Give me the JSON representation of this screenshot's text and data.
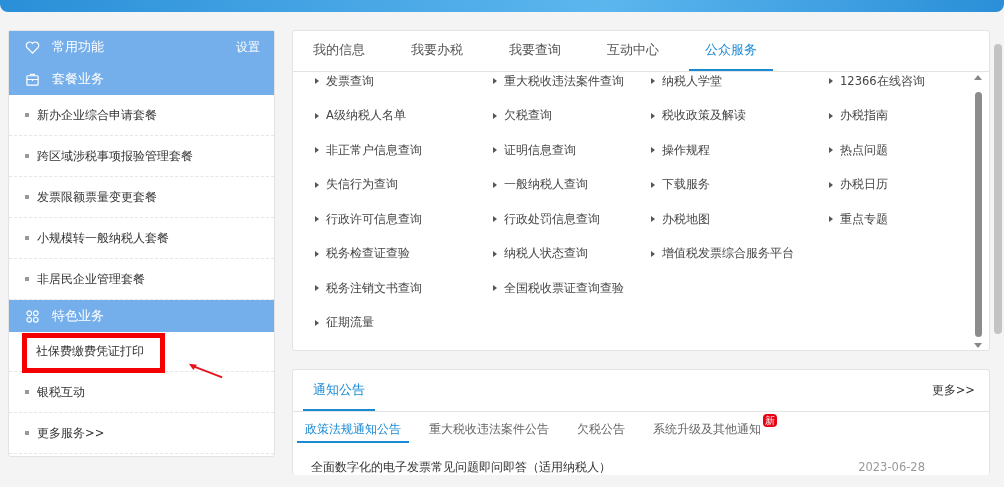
{
  "sidebar": {
    "sections": [
      {
        "title": "常用功能",
        "action": "设置"
      },
      {
        "title": "套餐业务",
        "items": [
          {
            "label": "新办企业综合申请套餐",
            "highlighted": false
          },
          {
            "label": "跨区域涉税事项报验管理套餐",
            "highlighted": false
          },
          {
            "label": "发票限额票量变更套餐",
            "highlighted": false
          },
          {
            "label": "小规模转一般纳税人套餐",
            "highlighted": false
          },
          {
            "label": "非居民企业管理套餐",
            "highlighted": false
          }
        ]
      },
      {
        "title": "特色业务",
        "items": [
          {
            "label": "社保费缴费凭证打印",
            "highlighted": true
          },
          {
            "label": "银税互动",
            "highlighted": false
          },
          {
            "label": "更多服务>>",
            "highlighted": false
          }
        ]
      }
    ]
  },
  "services": {
    "tabs": [
      {
        "label": "我的信息",
        "selected": false
      },
      {
        "label": "我要办税",
        "selected": false
      },
      {
        "label": "我要查询",
        "selected": false
      },
      {
        "label": "互动中心",
        "selected": false
      },
      {
        "label": "公众服务",
        "selected": true
      }
    ],
    "columns": [
      [
        "发票查询",
        "A级纳税人名单",
        "非正常户信息查询",
        "失信行为查询",
        "行政许可信息查询",
        "税务检查证查验",
        "税务注销文书查询",
        "征期流量"
      ],
      [
        "重大税收违法案件查询",
        "欠税查询",
        "证明信息查询",
        "一般纳税人查询",
        "行政处罚信息查询",
        "纳税人状态查询",
        "全国税收票证查询查验"
      ],
      [
        "纳税人学堂",
        "税收政策及解读",
        "操作规程",
        "下载服务",
        "办税地图",
        "增值税发票综合服务平台"
      ],
      [
        "12366在线咨询",
        "办税指南",
        "热点问题",
        "办税日历",
        "重点专题"
      ]
    ]
  },
  "notices": {
    "title": "通知公告",
    "more": "更多>>",
    "tabs": [
      {
        "label": "政策法规通知公告",
        "selected": true
      },
      {
        "label": "重大税收违法案件公告",
        "selected": false
      },
      {
        "label": "欠税公告",
        "selected": false
      },
      {
        "label": "系统升级及其他通知",
        "selected": false,
        "badge": "新"
      }
    ],
    "items": [
      {
        "title": "全面数字化的电子发票常见问题即问即答（适用纳税人）",
        "date": "2023-06-28"
      }
    ]
  }
}
